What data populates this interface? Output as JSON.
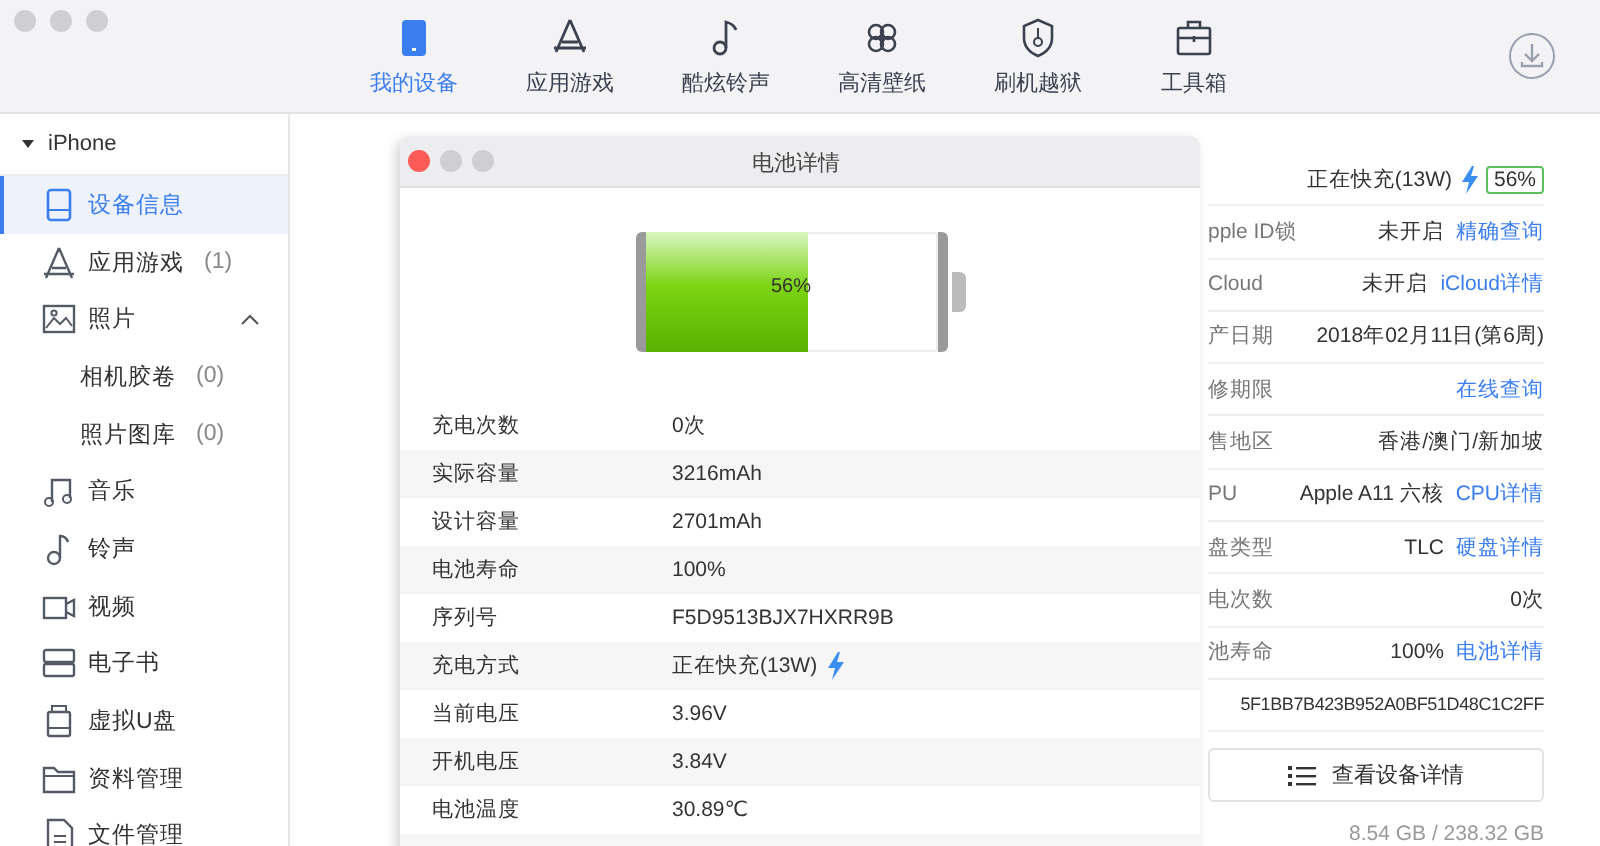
{
  "toolbar": {
    "tabs": [
      {
        "label": "我的设备",
        "selected": true
      },
      {
        "label": "应用游戏",
        "selected": false
      },
      {
        "label": "酷炫铃声",
        "selected": false
      },
      {
        "label": "高清壁纸",
        "selected": false
      },
      {
        "label": "刷机越狱",
        "selected": false
      },
      {
        "label": "工具箱",
        "selected": false
      }
    ]
  },
  "sidebar": {
    "device": "iPhone",
    "expanded": true,
    "items": [
      {
        "label": "设备信息",
        "selected": true
      },
      {
        "label": "应用游戏",
        "count": "(1)",
        "selected": false
      },
      {
        "label": "照片",
        "selected": false,
        "expanded": true,
        "children": [
          {
            "label": "相机胶卷",
            "count": "(0)",
            "selected": false
          },
          {
            "label": "照片图库",
            "count": "(0)",
            "selected": false
          }
        ]
      },
      {
        "label": "音乐",
        "selected": false
      },
      {
        "label": "铃声",
        "selected": false
      },
      {
        "label": "视频",
        "selected": false
      },
      {
        "label": "电子书",
        "selected": false
      },
      {
        "label": "虚拟U盘",
        "selected": false
      },
      {
        "label": "资料管理",
        "selected": false
      },
      {
        "label": "文件管理",
        "selected": false
      }
    ]
  },
  "info": {
    "status": {
      "text": "正在快充(13W)",
      "charging": true,
      "battery": "56%"
    },
    "rows": [
      {
        "label": "pple ID锁",
        "value": "未开启",
        "link": "精确查询"
      },
      {
        "label": "Cloud",
        "value": "未开启",
        "link": "iCloud详情"
      },
      {
        "label": "产日期",
        "value": "2018年02月11日(第6周)"
      },
      {
        "label": "修期限",
        "link": "在线查询"
      },
      {
        "label": "售地区",
        "value": "香港/澳门/新加坡"
      },
      {
        "label": "PU",
        "value": "Apple A11 六核",
        "link": "CPU详情"
      },
      {
        "label": "盘类型",
        "value": "TLC",
        "link": "硬盘详情"
      },
      {
        "label": "电次数",
        "value": "0次"
      },
      {
        "label": "池寿命",
        "value": "100%",
        "link": "电池详情"
      },
      {
        "value": "5F1BB7B423B952A0BF51D48C1C2FF"
      }
    ],
    "button": "查看设备详情",
    "storage": "8.54 GB / 238.32 GB"
  },
  "modal": {
    "title": "电池详情",
    "battery": {
      "level": 0.56,
      "reading": "56%"
    },
    "rows": [
      {
        "label": "充电次数",
        "value": "0次"
      },
      {
        "label": "实际容量",
        "value": "3216mAh"
      },
      {
        "label": "设计容量",
        "value": "2701mAh"
      },
      {
        "label": "电池寿命",
        "value": "100%"
      },
      {
        "label": "序列号",
        "value": "F5D9513BJX7HXRR9B"
      },
      {
        "label": "充电方式",
        "value": "正在快充(13W)",
        "charging": true
      },
      {
        "label": "当前电压",
        "value": "3.96V"
      },
      {
        "label": "开机电压",
        "value": "3.84V"
      },
      {
        "label": "电池温度",
        "value": "30.89℃"
      }
    ]
  }
}
